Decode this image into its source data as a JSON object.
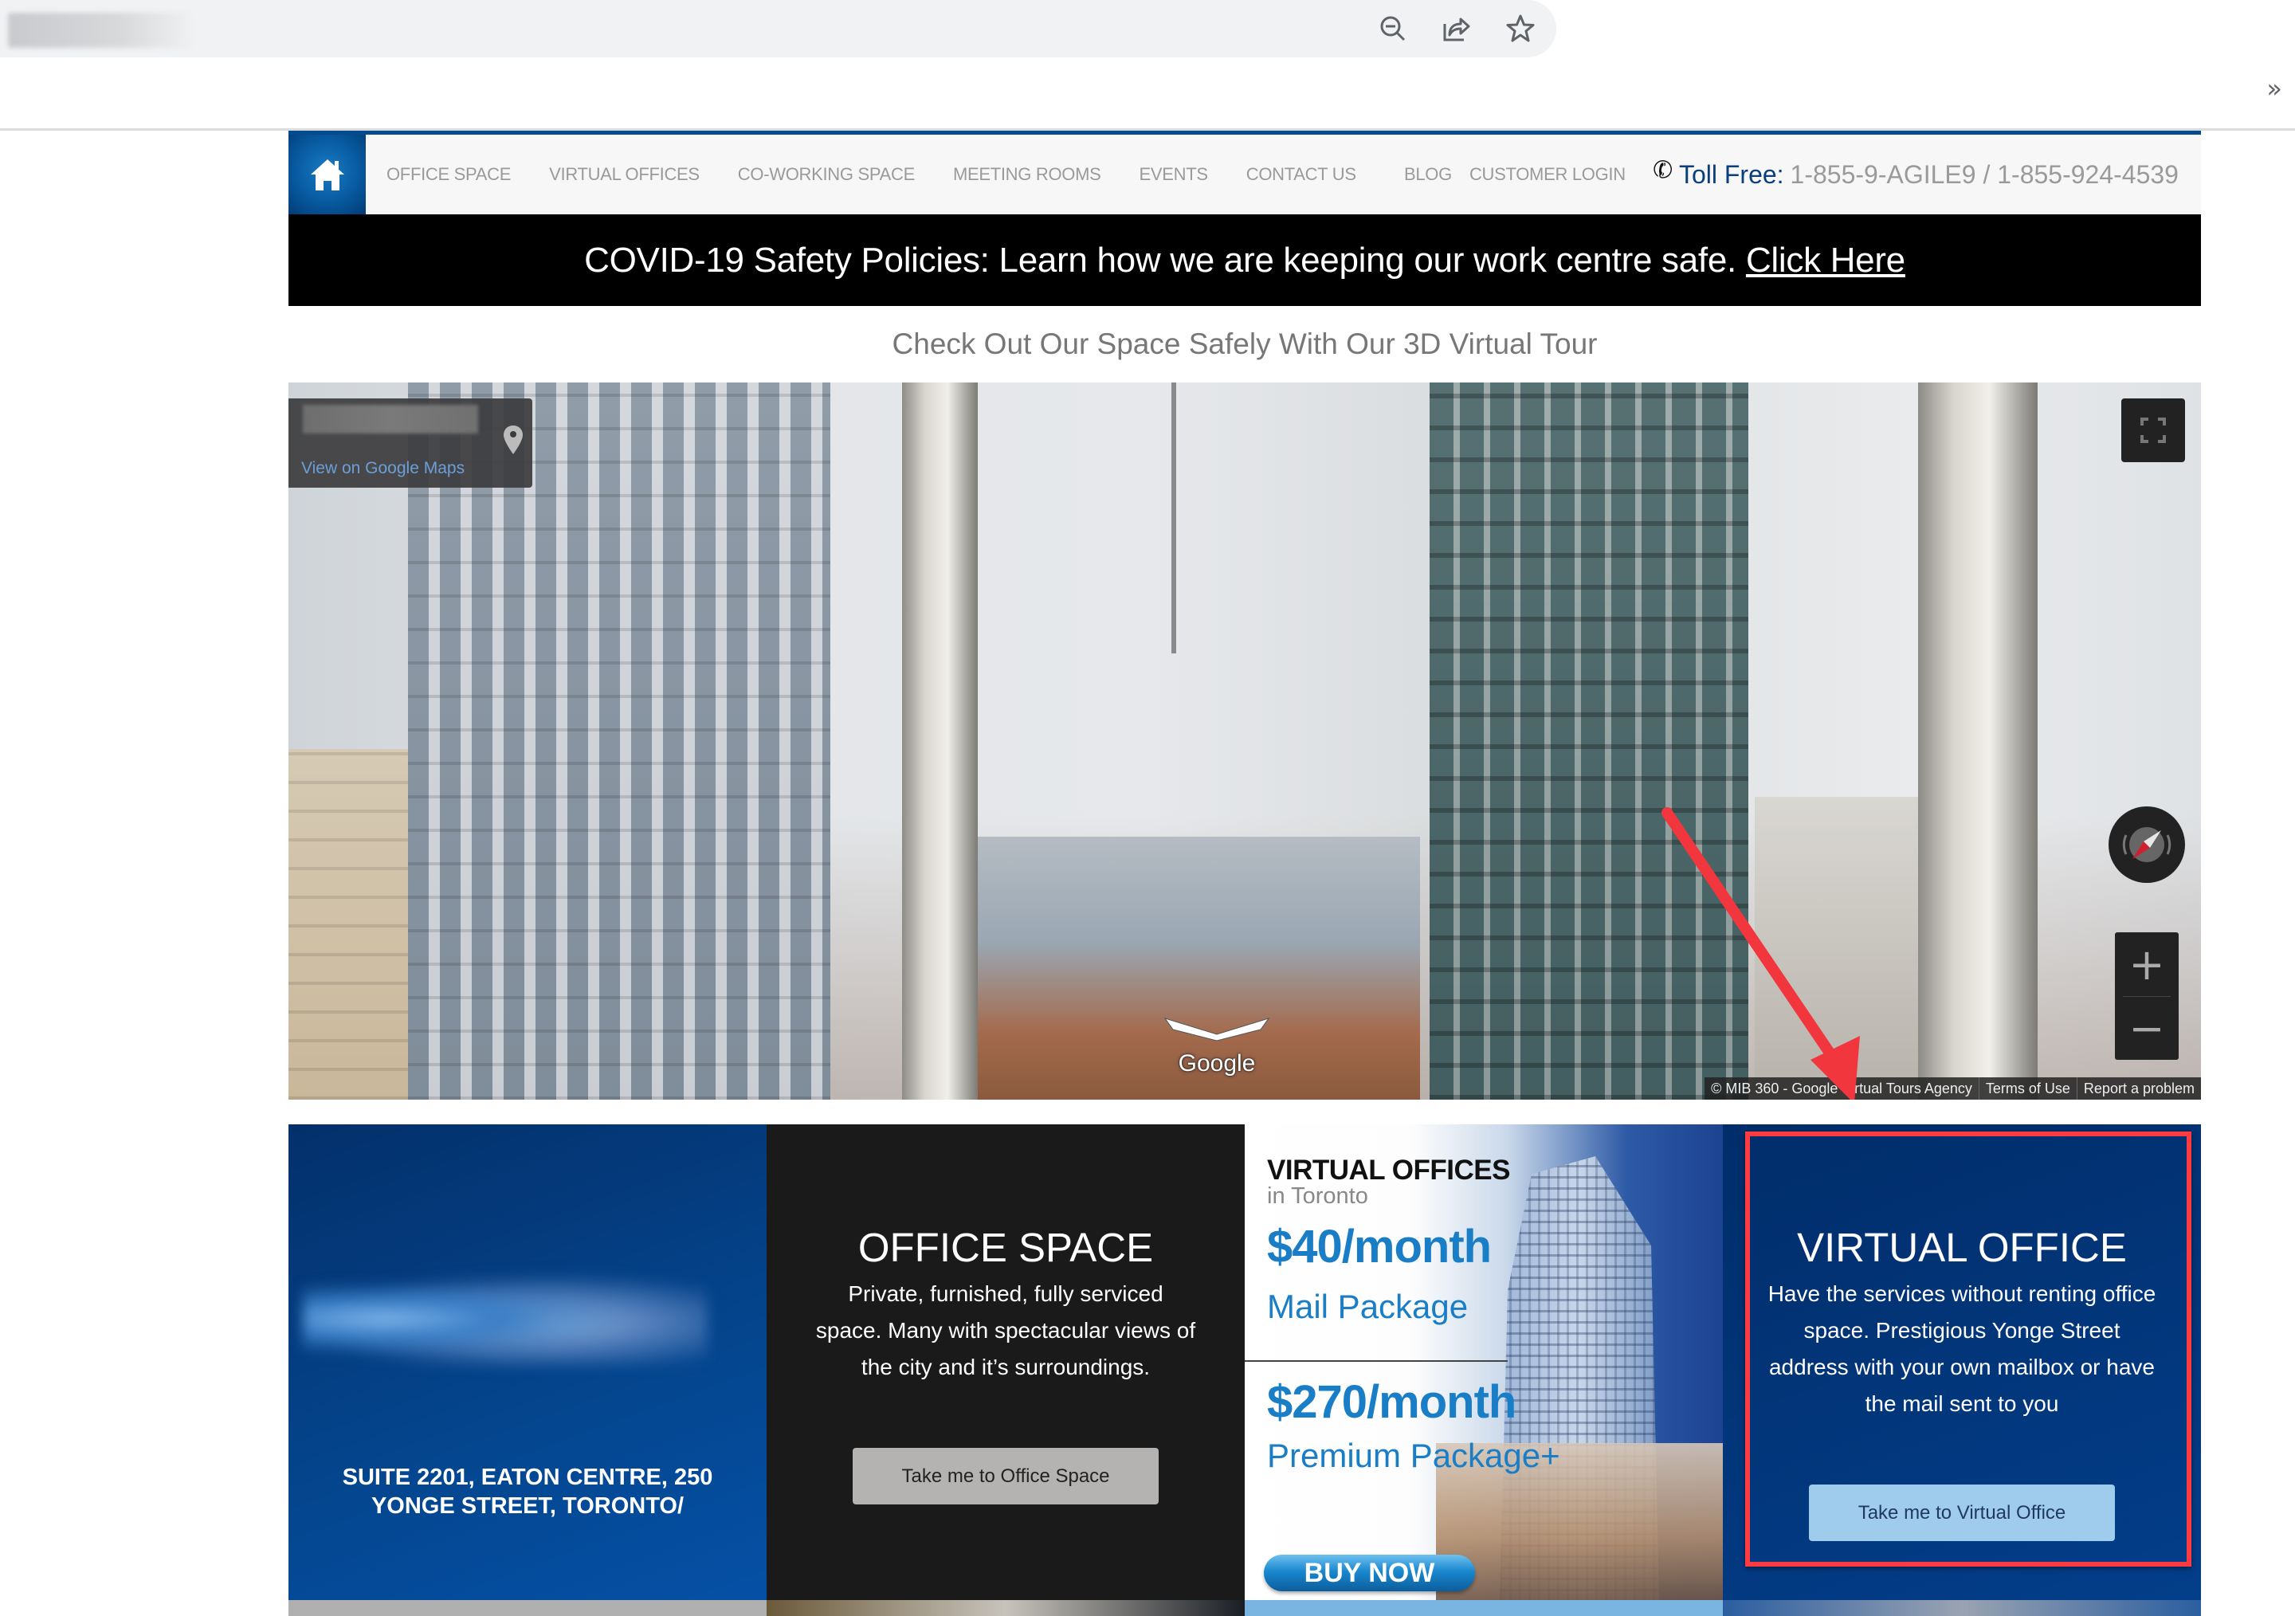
{
  "browser": {
    "toolbar_icons": [
      "zoom-out-icon",
      "share-icon",
      "bookmark-star-icon"
    ],
    "overflow_label": "»"
  },
  "nav": {
    "home_icon": "home-icon",
    "items": [
      "OFFICE SPACE",
      "VIRTUAL OFFICES",
      "CO-WORKING SPACE",
      "MEETING ROOMS",
      "EVENTS",
      "CONTACT US"
    ],
    "secondary": [
      "BLOG",
      "CUSTOMER LOGIN"
    ],
    "toll_free_label": "Toll Free:",
    "toll_free_numbers": "1-855-9-AGILE9 / 1-855-924-4539",
    "accent_color": "#054a8d"
  },
  "covid_banner": {
    "text": "COVID-19 Safety Policies: Learn how we are keeping our work centre safe.",
    "link_label": "Click Here"
  },
  "tour": {
    "heading": "Check Out Our Space Safely With Our 3D Virtual Tour",
    "maps_link": "View on Google Maps",
    "google_label": "Google",
    "attribution": [
      "© MIB 360 - Google Virtual Tours Agency",
      "Terms of Use",
      "Report a problem"
    ],
    "zoom_in_label": "+",
    "zoom_out_label": "−"
  },
  "cards": {
    "address": "SUITE 2201, EATON CENTRE, 250 YONGE STREET, TORONTO/",
    "office_space": {
      "title": "OFFICE SPACE",
      "description": "Private, furnished, fully serviced space. Many with spectacular views of the city and it’s surroundings.",
      "button": "Take me to Office Space"
    },
    "ad": {
      "title": "VIRTUAL OFFICES",
      "subtitle": "in Toronto",
      "price1": "$40/month",
      "package1": "Mail Package",
      "price2": "$270/month",
      "package2": "Premium Package+",
      "buy_label": "BUY NOW"
    },
    "virtual_office": {
      "title": "VIRTUAL OFFICE",
      "description": "Have the services without renting office space. Prestigious Yonge Street address with your own mailbox or have the mail sent to you",
      "button": "Take me to Virtual Office",
      "highlight_color": "#ff3b42"
    }
  }
}
